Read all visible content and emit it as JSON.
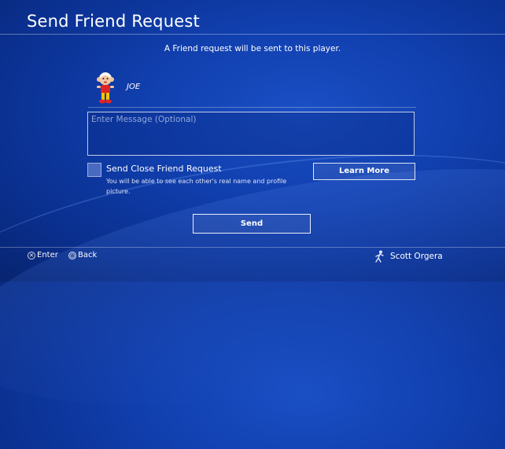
{
  "screen": {
    "title": "Send Friend Request"
  },
  "info_text": "A Friend request will be sent to this player.",
  "player": {
    "name": "JOE",
    "avatar_icon": "monkey-avatar-icon"
  },
  "message": {
    "placeholder": "Enter Message (Optional)",
    "value": ""
  },
  "close_friend": {
    "label": "Send Close Friend Request",
    "description": "You will be able to see each other's real name and profile picture.",
    "checked": false
  },
  "learn_more_label": "Learn More",
  "send_label": "Send",
  "footer": {
    "enter_label": "Enter",
    "back_label": "Back",
    "user_name": "Scott Orgera"
  },
  "colors": {
    "background": "#1140b0",
    "text": "#ffffff"
  }
}
